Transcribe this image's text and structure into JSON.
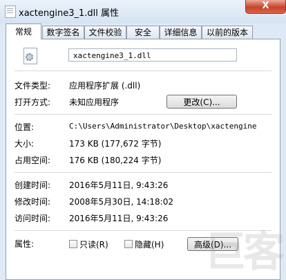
{
  "window": {
    "title": "xactengine3_1.dll 属性",
    "close_glyph": "X"
  },
  "tabs": [
    {
      "label": "常规",
      "active": true
    },
    {
      "label": "数字签名"
    },
    {
      "label": "文件校验"
    },
    {
      "label": "安全"
    },
    {
      "label": "详细信息"
    },
    {
      "label": "以前的版本"
    }
  ],
  "general": {
    "file_name": "xactengine3_1.dll",
    "file_type_label": "文件类型:",
    "file_type_value": "应用程序扩展 (.dll)",
    "open_with_label": "打开方式:",
    "open_with_value": "未知应用程序",
    "change_button": "更改(C)...",
    "location_label": "位置:",
    "location_value": "C:\\Users\\Administrator\\Desktop\\xactengine",
    "size_label": "大小:",
    "size_value": "173 KB (177,672 字节)",
    "size_on_disk_label": "占用空间:",
    "size_on_disk_value": "176 KB (180,224 字节)",
    "created_label": "创建时间:",
    "created_value": "2016年5月11日, 9:43:26",
    "modified_label": "修改时间:",
    "modified_value": "2008年5月30日, 14:18:02",
    "accessed_label": "访问时间:",
    "accessed_value": "2016年5月11日, 9:43:26",
    "attributes_label": "属性:",
    "readonly_label": "只读(R)",
    "hidden_label": "隐藏(H)",
    "advanced_button": "高级(D)..."
  },
  "watermark": "巨客"
}
